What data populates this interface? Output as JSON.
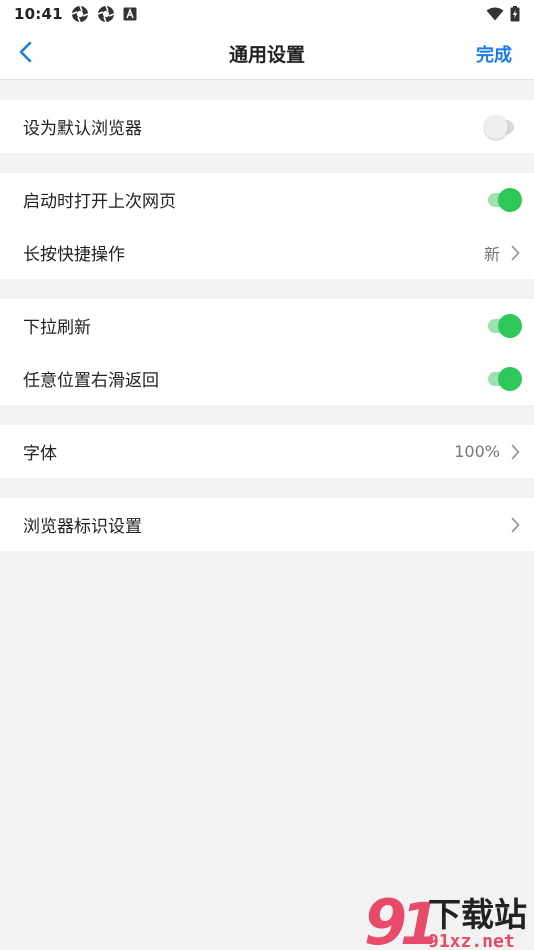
{
  "status_bar": {
    "time": "10:41",
    "icons": [
      "aperture-icon",
      "aperture-icon",
      "notification-a-icon"
    ],
    "right_icons": [
      "wifi-icon",
      "battery-charging-icon"
    ]
  },
  "navbar": {
    "title": "通用设置",
    "done_label": "完成",
    "accent_color": "#1a7ce6"
  },
  "groups": [
    {
      "rows": [
        {
          "label": "设为默认浏览器",
          "control": "toggle",
          "on": false
        }
      ]
    },
    {
      "rows": [
        {
          "label": "启动时打开上次网页",
          "control": "toggle",
          "on": true
        },
        {
          "label": "长按快捷操作",
          "control": "link",
          "value": "新"
        }
      ]
    },
    {
      "rows": [
        {
          "label": "下拉刷新",
          "control": "toggle",
          "on": true
        },
        {
          "label": "任意位置右滑返回",
          "control": "toggle",
          "on": true
        }
      ]
    },
    {
      "rows": [
        {
          "label": "字体",
          "control": "link",
          "value": "100%"
        }
      ]
    },
    {
      "rows": [
        {
          "label": "浏览器标识设置",
          "control": "link",
          "value": ""
        }
      ]
    }
  ],
  "toggle_on_color": "#2ec85a",
  "watermark": {
    "text": "下载站",
    "url_text": "91xz.net"
  }
}
